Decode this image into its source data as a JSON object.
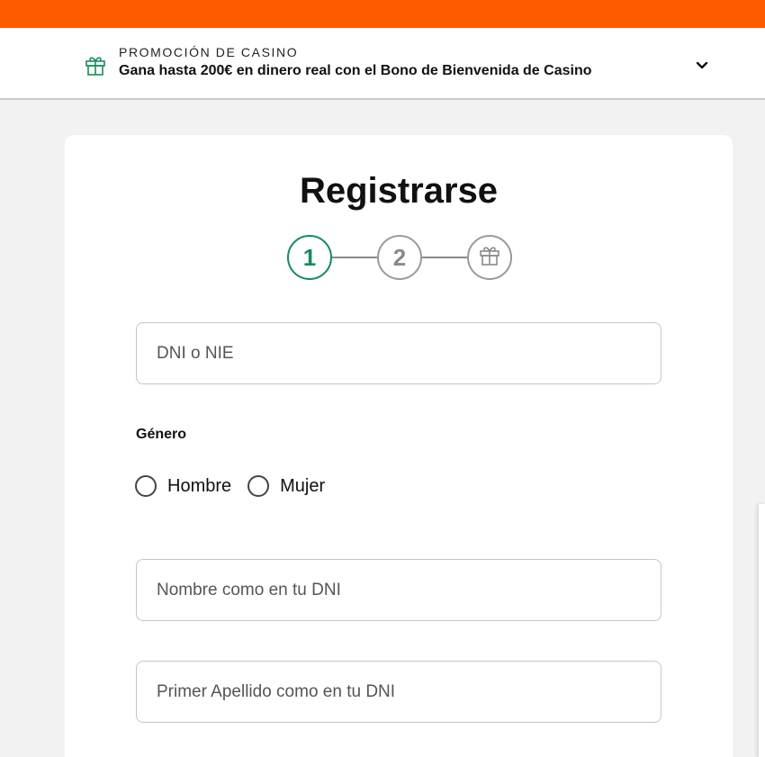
{
  "colors": {
    "brand_orange": "#ff5a00",
    "step_active_green": "#188a5a",
    "step_inactive_gray": "#8a8a8a",
    "gift_icon_green": "#1f8a5c"
  },
  "promo": {
    "kicker": "PROMOCIÓN DE CASINO",
    "title": "Gana hasta 200€ en dinero real con el Bono de Bienvenida de Casino",
    "gift_icon": "gift-icon",
    "toggle_icon": "chevron-down-icon"
  },
  "registration": {
    "title": "Registrarse",
    "steps": [
      {
        "label": "1",
        "state": "active"
      },
      {
        "label": "2",
        "state": "inactive"
      },
      {
        "icon": "gift-icon",
        "state": "inactive"
      }
    ],
    "fields": {
      "dni": {
        "placeholder": "DNI o NIE",
        "value": ""
      },
      "first_name": {
        "placeholder": "Nombre como en tu DNI",
        "value": ""
      },
      "last_name": {
        "placeholder": "Primer Apellido como en tu DNI",
        "value": ""
      }
    },
    "gender": {
      "label": "Género",
      "options": [
        "Hombre",
        "Mujer"
      ]
    }
  }
}
